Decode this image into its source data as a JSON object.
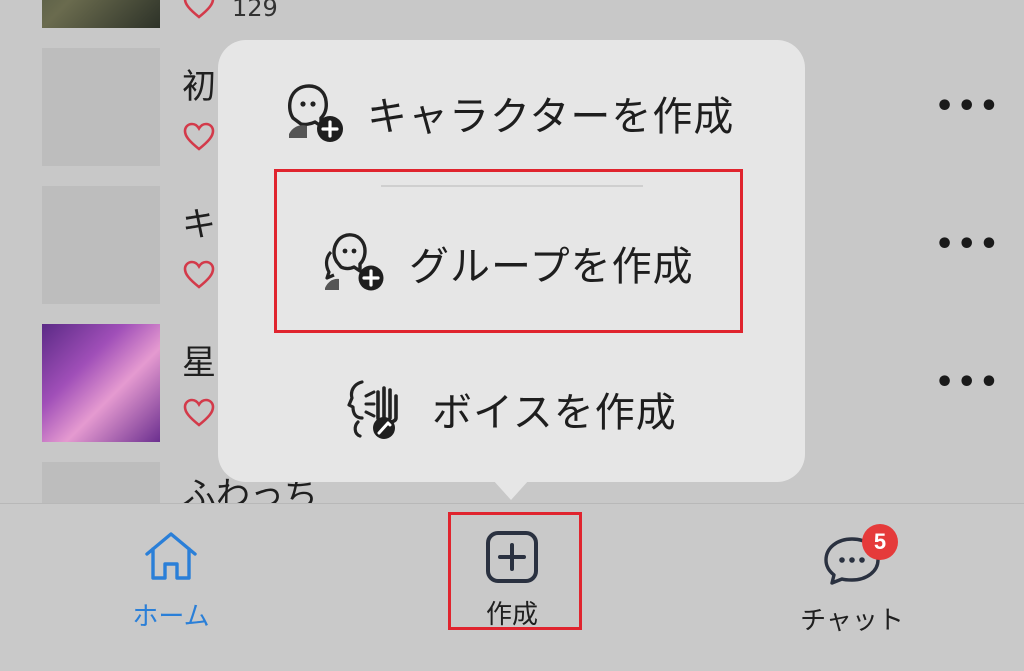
{
  "list": {
    "rows": [
      {
        "title": "",
        "count": "129"
      },
      {
        "title": "初"
      },
      {
        "title": "キ"
      },
      {
        "title": "星"
      },
      {
        "title": "ふわっち"
      }
    ],
    "more_icon": "more-horizontal-icon"
  },
  "popover": {
    "items": [
      {
        "label": "キャラクターを作成",
        "icon": "character-add-icon"
      },
      {
        "label": "グループを作成",
        "icon": "group-add-icon"
      },
      {
        "label": "ボイスを作成",
        "icon": "voice-create-icon"
      }
    ]
  },
  "tabbar": {
    "home": {
      "label": "ホーム",
      "icon": "home-icon"
    },
    "create": {
      "label": "作成",
      "icon": "plus-square-icon"
    },
    "chat": {
      "label": "チャット",
      "icon": "chat-bubble-icon",
      "badge": "5"
    }
  },
  "colors": {
    "accent": "#2a7fd8",
    "highlight": "#e0242e",
    "badge": "#e53a3a",
    "heart": "#d33a4a"
  }
}
